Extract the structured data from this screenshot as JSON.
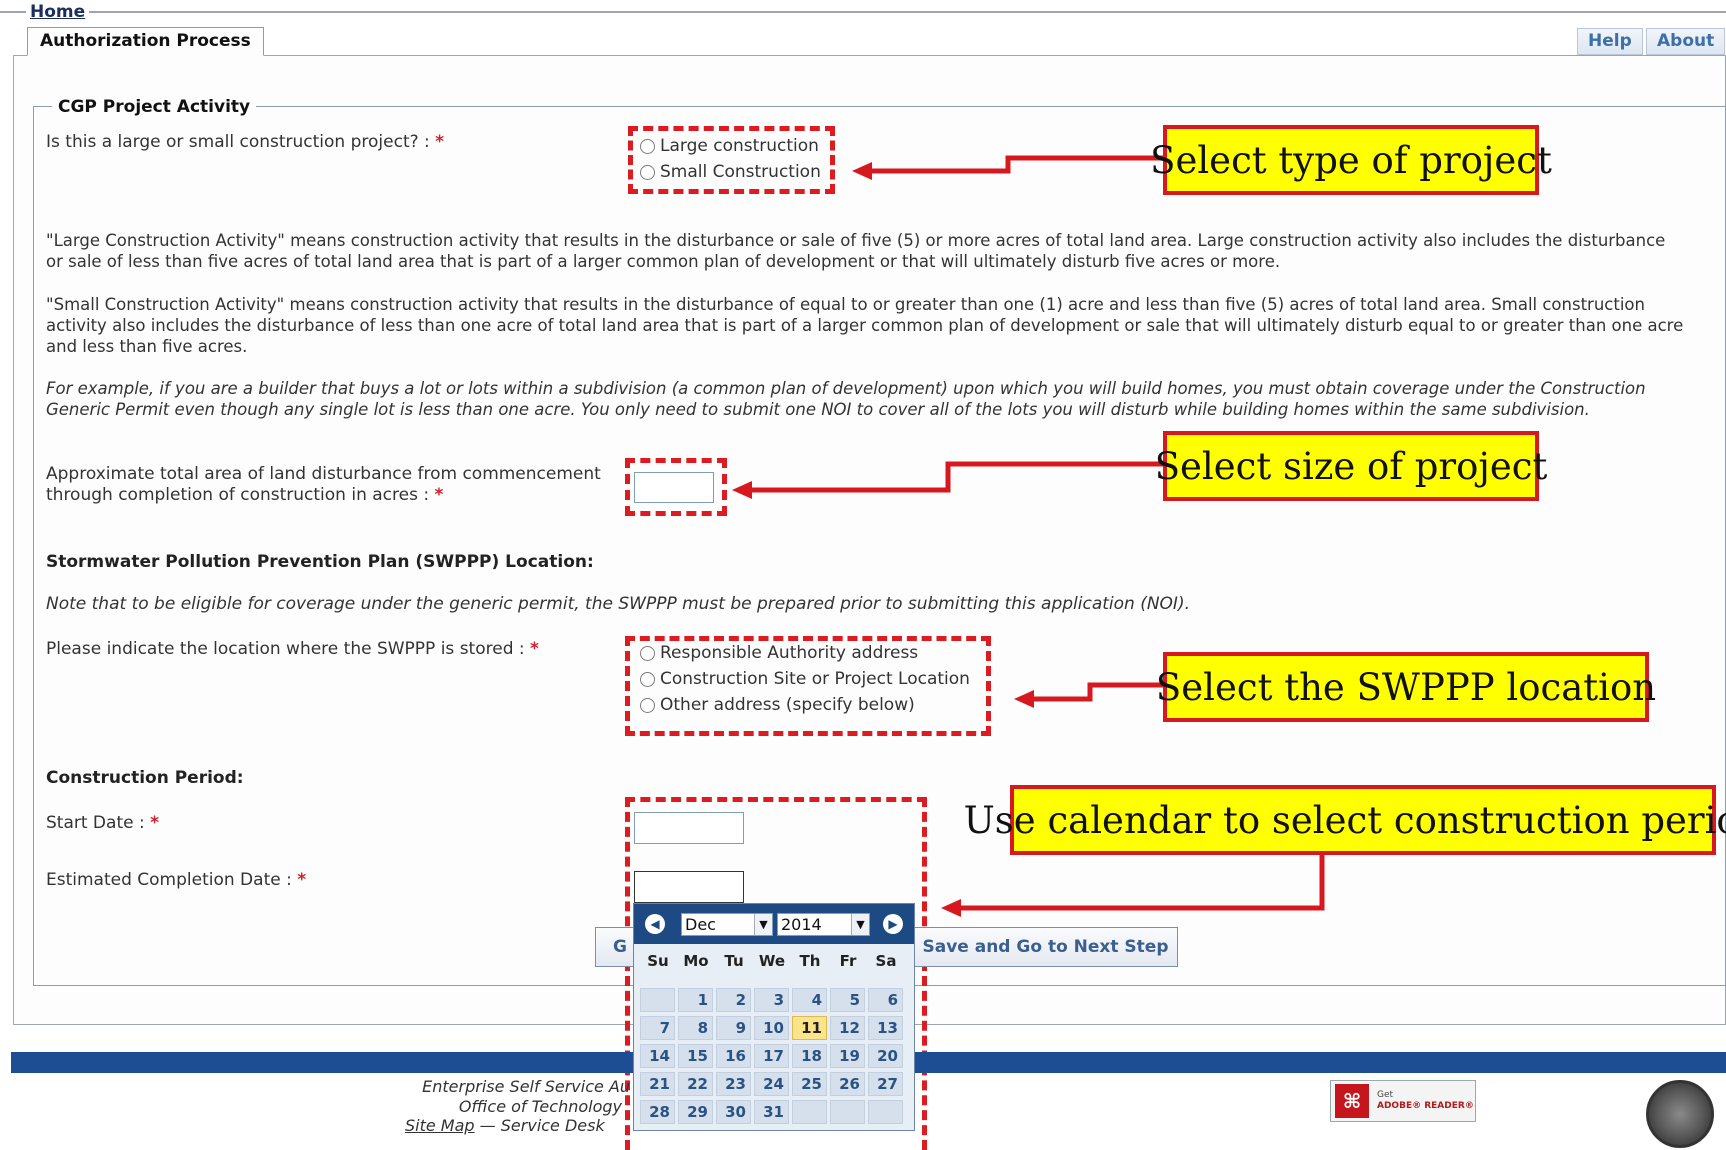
{
  "nav": {
    "home": "Home",
    "active_tab": "Authorization Process",
    "help": "Help",
    "about": "About"
  },
  "form": {
    "legend": "CGP Project Activity",
    "project_question": "Is this a large or small construction project? :",
    "required_mark": "*",
    "project_options": [
      "Large construction",
      "Small Construction"
    ],
    "large_def": "\"Large Construction Activity\" means construction activity that results in the disturbance or sale of five (5) or more acres of total land area. Large construction activity also includes the disturbance or sale of less than five acres of total land area that is part of a larger common plan of development or that will ultimately disturb five acres or more.",
    "small_def": "\"Small Construction Activity\" means construction activity that results in the disturbance of equal to or greater than one (1) acre and less than five (5) acres of total land area. Small construction activity also includes the disturbance of less than one acre of total land area that is part of a larger common plan of development or sale that will ultimately disturb equal to or greater than one acre and less than five acres.",
    "example": "For example, if you are a builder that buys a lot or lots within a subdivision (a common plan of development) upon which you will build homes, you must obtain coverage under the Construction Generic Permit even though any single lot is less than one acre. You only need to submit one NOI to cover all of the lots you will disturb while building homes within the same subdivision.",
    "area_label_1": "Approximate total area of land disturbance from commencement",
    "area_label_2": "through completion of construction in acres :",
    "area_value": "",
    "swppp_heading": "Stormwater Pollution Prevention Plan (SWPPP) Location:",
    "swppp_note": "Note that to be eligible for coverage under the generic permit, the SWPPP must be prepared prior to submitting this application (NOI).",
    "swppp_question": "Please indicate the location where the SWPPP is stored :",
    "swppp_options": [
      "Responsible Authority address",
      "Construction Site or Project Location",
      "Other address (specify below)"
    ],
    "period_heading": "Construction Period:",
    "start_label": "Start Date :",
    "completion_label": "Estimated Completion Date :",
    "start_value": "",
    "completion_value": "",
    "back_button": "G",
    "next_button": "Save and Go to Next Step"
  },
  "calendar": {
    "month": "Dec",
    "year": "2014",
    "days_of_week": [
      "Su",
      "Mo",
      "Tu",
      "We",
      "Th",
      "Fr",
      "Sa"
    ],
    "weeks": [
      [
        "",
        "1",
        "2",
        "3",
        "4",
        "5",
        "6"
      ],
      [
        "7",
        "8",
        "9",
        "10",
        "11",
        "12",
        "13"
      ],
      [
        "14",
        "15",
        "16",
        "17",
        "18",
        "19",
        "20"
      ],
      [
        "21",
        "22",
        "23",
        "24",
        "25",
        "26",
        "27"
      ],
      [
        "28",
        "29",
        "30",
        "31",
        "",
        "",
        ""
      ]
    ],
    "today": "11",
    "prev_icon": "chevron-left-icon",
    "next_icon": "chevron-right-icon"
  },
  "callouts": {
    "type": "Select type of project",
    "size": "Select size of project",
    "location": "Select the SWPPP location",
    "period": "Use calendar to select construction period"
  },
  "footer": {
    "line1": "Enterprise Self Service Au",
    "line2": "Office of Technology",
    "site_map": "Site Map",
    "separator": "—",
    "service_desk": "Service Desk",
    "adobe_small": "Get",
    "adobe_brand": "ADOBE® READER®"
  },
  "colors": {
    "accent_red": "#dd1c22",
    "callout_yellow": "#ffff00",
    "footer_blue": "#1d4e93",
    "link_blue": "#3d6fa8"
  }
}
